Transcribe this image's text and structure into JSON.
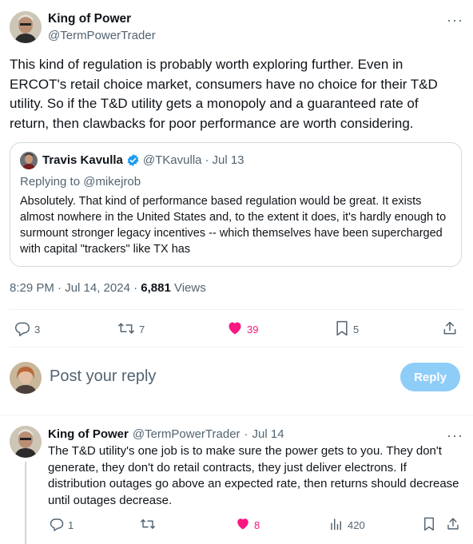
{
  "main_tweet": {
    "author_name": "King of Power",
    "author_handle": "@TermPowerTrader",
    "more_icon": "more-horizontal-icon",
    "text": "This kind of regulation is probably worth exploring further.  Even in ERCOT's retail choice market, consumers have no choice for their T&D utility.  So if the T&D utility gets a monopoly and a guaranteed rate of return, then clawbacks for poor performance are worth considering.",
    "quoted": {
      "author_name": "Travis Kavulla",
      "author_handle": "@TKavulla",
      "dot": "·",
      "date": "Jul 13",
      "replying_to": "Replying to @mikejrob",
      "text": "Absolutely. That kind of performance based regulation would be great. It exists almost nowhere in the United States and, to the extent it does, it's hardly enough to surmount stronger legacy incentives -- which themselves have been supercharged with capital \"trackers\" like TX has"
    },
    "timestamp": "8:29 PM · Jul 14, 2024 · ",
    "views_count": "6,881",
    "views_label": " Views",
    "actions": {
      "replies": "3",
      "reposts": "7",
      "likes": "39",
      "bookmarks": "5"
    }
  },
  "reply_box": {
    "placeholder": "Post your reply",
    "button_label": "Reply"
  },
  "reply_tweet": {
    "author_name": "King of Power",
    "author_handle": "@TermPowerTrader",
    "dot": "·",
    "date": "Jul 14",
    "text": "The T&D utility's one job is to make sure the power gets to you.  They don't generate, they don't do retail contracts, they just deliver electrons.  If distribution outages go above an expected rate, then returns should decrease until outages decrease.",
    "actions": {
      "replies": "1",
      "likes": "8",
      "views": "420"
    }
  },
  "colors": {
    "like_pink": "#f91880",
    "verified_blue": "#1d9bf0",
    "reply_button": "#8ecdf8",
    "secondary_text": "#536471"
  }
}
